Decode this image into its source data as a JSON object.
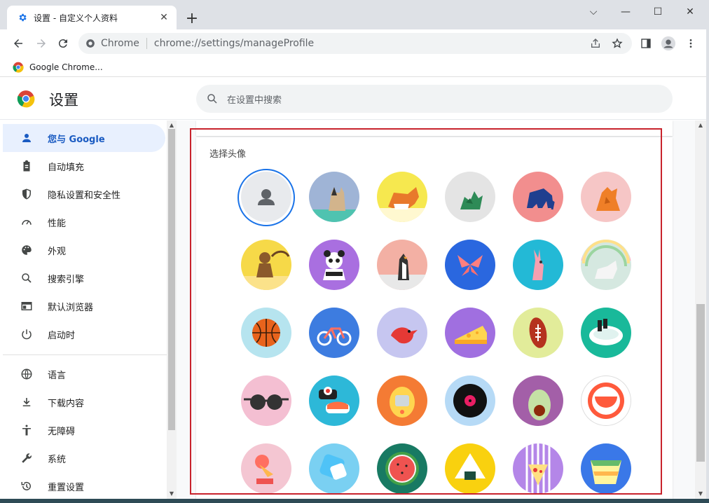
{
  "browser": {
    "tab_title": "设置 - 自定义个人资料",
    "tab_close": "✕",
    "new_tab": "+",
    "window_controls": [
      "⌵",
      "—",
      "☐",
      "✕"
    ],
    "site_label": "Chrome",
    "url": "chrome://settings/manageProfile",
    "bookmark_label": "Google Chrome..."
  },
  "settings": {
    "title": "设置",
    "search_placeholder": "在设置中搜索"
  },
  "sidebar": {
    "items": [
      {
        "label": "您与 Google",
        "icon": "person-icon",
        "active": true
      },
      {
        "label": "自动填充",
        "icon": "clipboard-icon"
      },
      {
        "label": "隐私设置和安全性",
        "icon": "shield-icon"
      },
      {
        "label": "性能",
        "icon": "speedometer-icon"
      },
      {
        "label": "外观",
        "icon": "palette-icon"
      },
      {
        "label": "搜索引擎",
        "icon": "search-icon"
      },
      {
        "label": "默认浏览器",
        "icon": "browser-window-icon"
      },
      {
        "label": "启动时",
        "icon": "power-icon"
      },
      {
        "label": "语言",
        "icon": "globe-icon"
      },
      {
        "label": "下载内容",
        "icon": "download-icon"
      },
      {
        "label": "无障碍",
        "icon": "accessibility-icon"
      },
      {
        "label": "系统",
        "icon": "wrench-icon"
      },
      {
        "label": "重置设置",
        "icon": "history-icon"
      }
    ]
  },
  "avatar_picker": {
    "heading": "选择头像",
    "avatars": [
      {
        "name": "generic-avatar",
        "bg": "#e8eaed",
        "selected": true
      },
      {
        "name": "cat-avatar",
        "bg": "#9fb4d6"
      },
      {
        "name": "corgi-avatar",
        "bg": "#f6e84f"
      },
      {
        "name": "dragon-avatar",
        "bg": "#e4e4e4"
      },
      {
        "name": "elephant-avatar",
        "bg": "#f28e8e"
      },
      {
        "name": "fox-avatar",
        "bg": "#f6c6c6"
      },
      {
        "name": "monkey-avatar",
        "bg": "#f6d948"
      },
      {
        "name": "panda-avatar",
        "bg": "#a96fe0"
      },
      {
        "name": "penguin-avatar",
        "bg": "#f3b0a4"
      },
      {
        "name": "butterfly-avatar",
        "bg": "#2a67df"
      },
      {
        "name": "rabbit-avatar",
        "bg": "#23b9d6"
      },
      {
        "name": "unicorn-avatar",
        "bg": "#d5e8e0"
      },
      {
        "name": "basketball-avatar",
        "bg": "#b6e4ef"
      },
      {
        "name": "bicycle-avatar",
        "bg": "#3d7ce0"
      },
      {
        "name": "bird-avatar",
        "bg": "#c6c6f0"
      },
      {
        "name": "cheese-avatar",
        "bg": "#a06fe0"
      },
      {
        "name": "football-avatar",
        "bg": "#e2ec9a"
      },
      {
        "name": "ramen-avatar",
        "bg": "#19b99a"
      },
      {
        "name": "sunglasses-avatar",
        "bg": "#f4bfd2"
      },
      {
        "name": "sushi-avatar",
        "bg": "#2db8d8"
      },
      {
        "name": "tamagotchi-avatar",
        "bg": "#f47b34"
      },
      {
        "name": "vinyl-avatar",
        "bg": "#b6daf6"
      },
      {
        "name": "avocado-avatar",
        "bg": "#a35fa8"
      },
      {
        "name": "smile-avatar",
        "bg": "#ffffff"
      },
      {
        "name": "ice-cream-avatar",
        "bg": "#f4c6d2"
      },
      {
        "name": "ice-cubes-avatar",
        "bg": "#7ad0f2"
      },
      {
        "name": "watermelon-avatar",
        "bg": "#187a63"
      },
      {
        "name": "onigiri-avatar",
        "bg": "#f9d10f"
      },
      {
        "name": "pizza-avatar",
        "bg": "#b486e8"
      },
      {
        "name": "sandwich-avatar",
        "bg": "#3a78e8"
      }
    ]
  }
}
